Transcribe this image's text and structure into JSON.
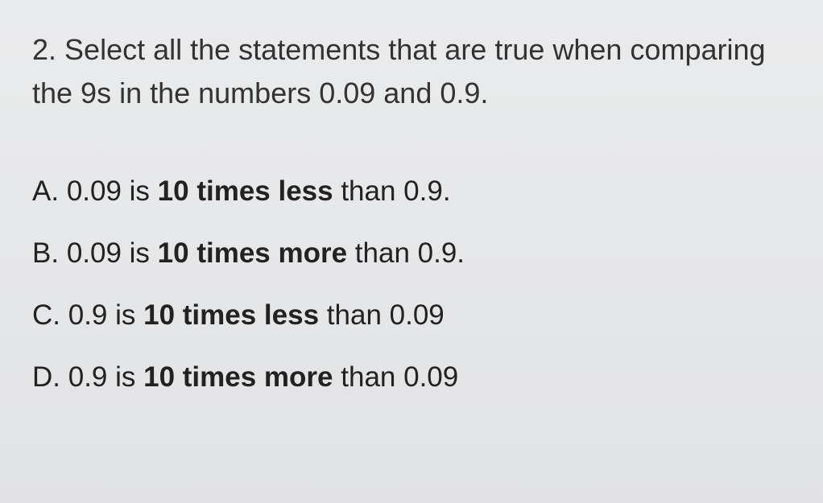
{
  "question": {
    "number": "2.",
    "prompt": "Select all the statements that are true when comparing the 9s in the numbers 0.09 and 0.9."
  },
  "options": [
    {
      "letter": "A.",
      "part1": "0.09 is ",
      "bold": "10 times less",
      "part2": " than 0.9."
    },
    {
      "letter": "B.",
      "part1": "0.09 is ",
      "bold": "10 times more",
      "part2": " than 0.9."
    },
    {
      "letter": "C.",
      "part1": "0.9 is ",
      "bold": "10 times less",
      "part2": " than 0.09"
    },
    {
      "letter": "D.",
      "part1": "0.9 is ",
      "bold": "10 times more",
      "part2": " than 0.09"
    }
  ]
}
